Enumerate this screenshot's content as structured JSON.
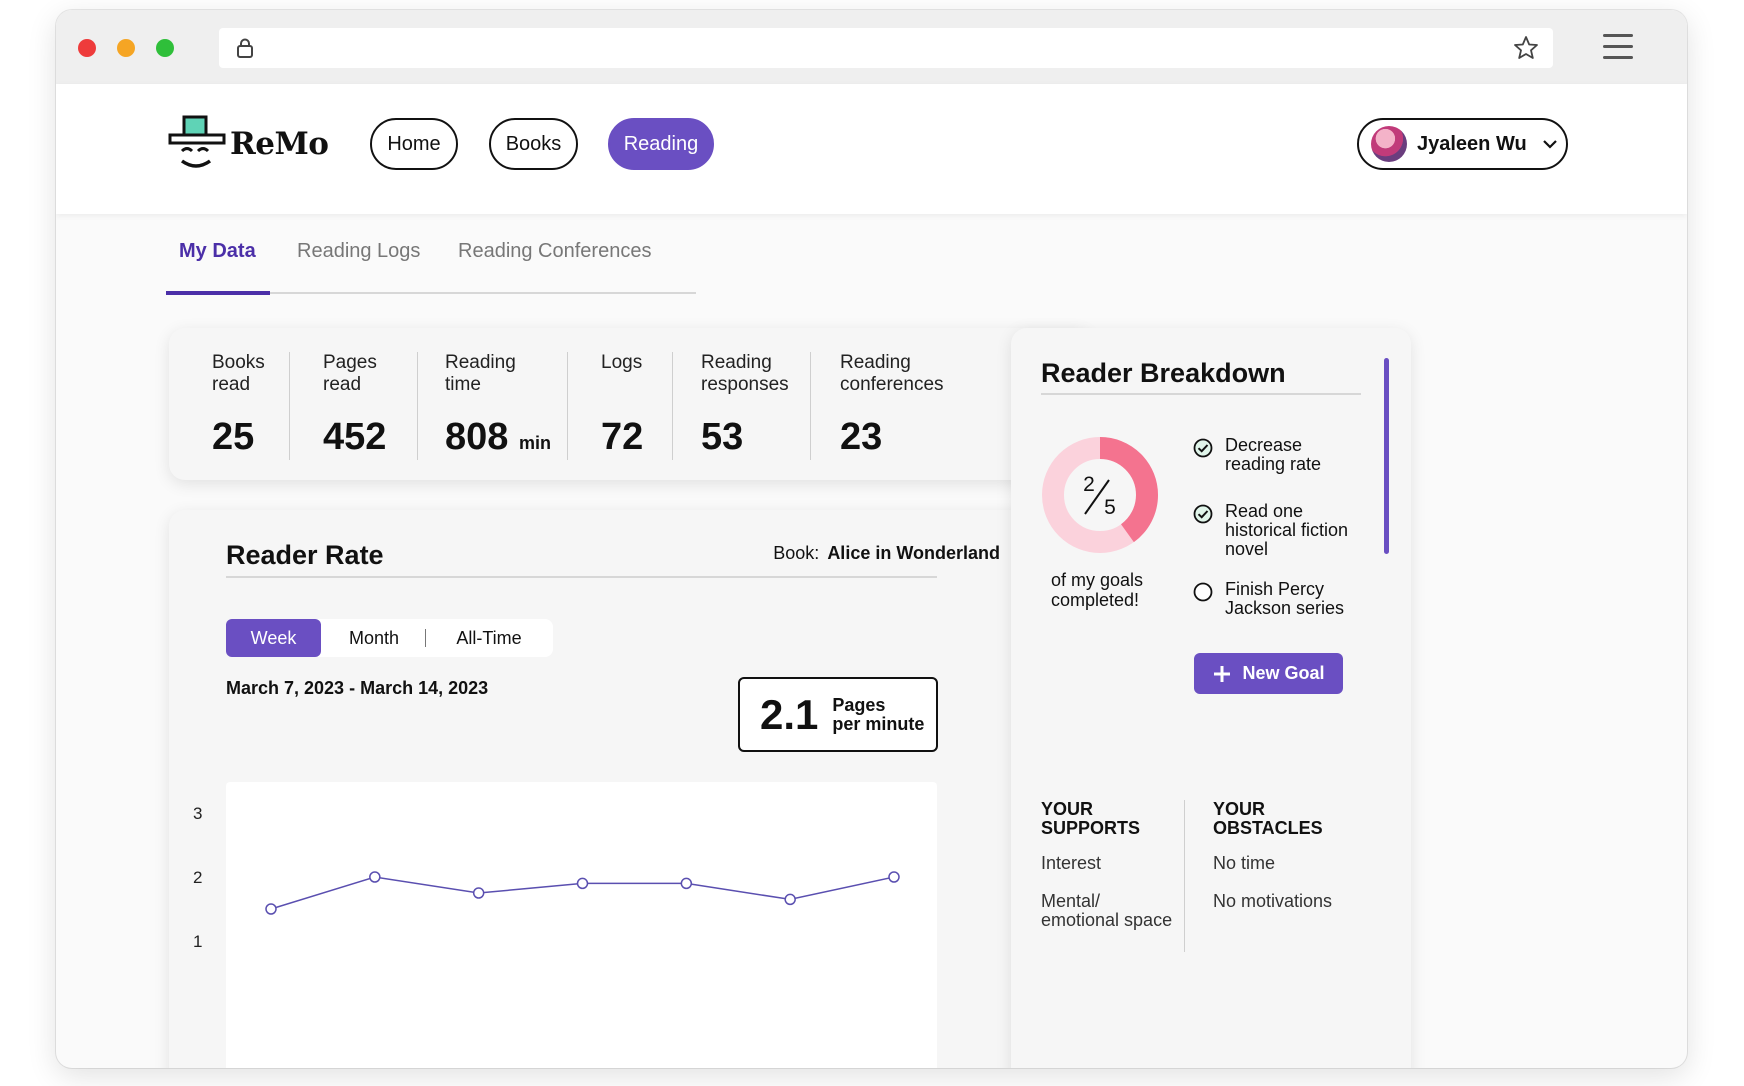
{
  "app": {
    "name": "ReMo",
    "accent_color": "#6a4fc2"
  },
  "nav": {
    "home_label": "Home",
    "books_label": "Books",
    "reading_label": "Reading",
    "active": "Reading"
  },
  "user": {
    "name": "Jyaleen Wu"
  },
  "tabs": [
    {
      "label": "My Data",
      "active": true
    },
    {
      "label": "Reading Logs",
      "active": false
    },
    {
      "label": "Reading Conferences",
      "active": false
    }
  ],
  "stats": [
    {
      "label": "Books read",
      "value": "25",
      "unit": ""
    },
    {
      "label": "Pages read",
      "value": "452",
      "unit": ""
    },
    {
      "label": "Reading time",
      "value": "808",
      "unit": "min"
    },
    {
      "label": "Logs",
      "value": "72",
      "unit": ""
    },
    {
      "label": "Reading responses",
      "value": "53",
      "unit": ""
    },
    {
      "label": "Reading conferences",
      "value": "23",
      "unit": ""
    }
  ],
  "reader_rate": {
    "title": "Reader Rate",
    "book_label": "Book:",
    "book_value": "Alice in Wonderland",
    "periods": [
      "Week",
      "Month",
      "All-Time"
    ],
    "active_period": "Week",
    "date_range": "March 7, 2023 - March 14, 2023",
    "pages_per_minute": "2.1",
    "pages_per_minute_label_1": "Pages",
    "pages_per_minute_label_2": "per minute"
  },
  "chart_data": {
    "type": "line",
    "x": [
      1,
      2,
      3,
      4,
      5,
      6,
      7
    ],
    "values": [
      1.5,
      2.0,
      1.75,
      1.9,
      1.9,
      1.65,
      2.0
    ],
    "yticks": [
      "3",
      "2",
      "1"
    ],
    "ylim": [
      1,
      3
    ],
    "line_color": "#5a4fb0"
  },
  "breakdown": {
    "title": "Reader Breakdown",
    "goals_done": "2",
    "goals_total": "5",
    "goals_fraction": 0.4,
    "caption": "of my goals completed!",
    "goals": [
      {
        "text": "Decrease reading rate",
        "done": true
      },
      {
        "text": "Read one historical fiction novel",
        "done": true
      },
      {
        "text": "Finish Percy Jackson series",
        "done": false
      }
    ],
    "new_goal_label": "New Goal",
    "supports_title": "YOUR SUPPORTS",
    "supports": [
      "Interest",
      "Mental/ emotional space"
    ],
    "obstacles_title": "YOUR OBSTACLES",
    "obstacles": [
      "No time",
      "No motivations"
    ]
  }
}
